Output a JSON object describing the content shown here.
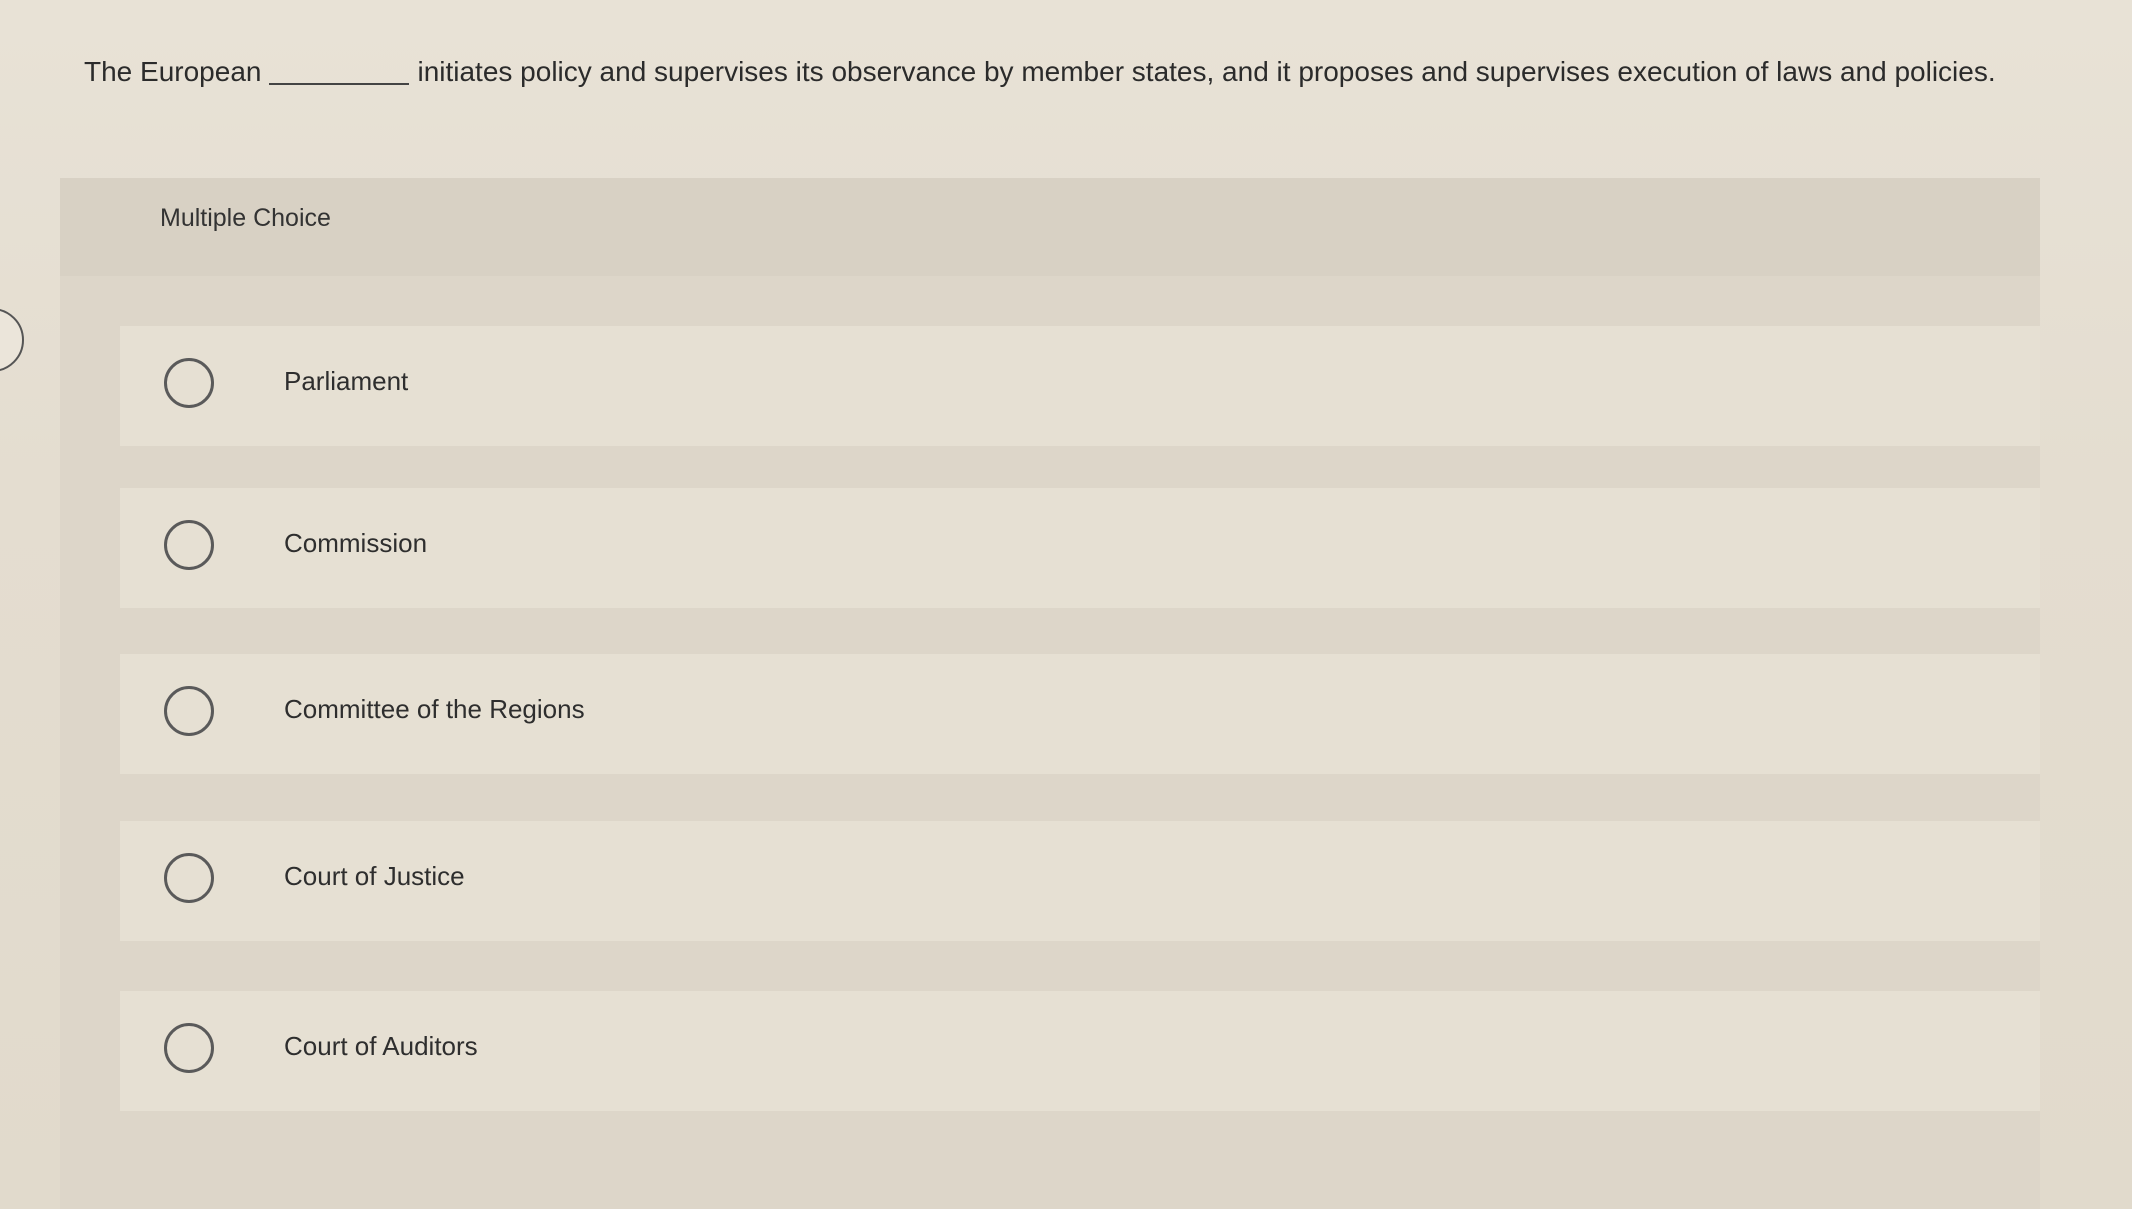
{
  "question": {
    "before_blank": "The European",
    "after_blank": "initiates policy and supervises its observance by member states, and it proposes and supervises execution of laws and policies."
  },
  "multiple_choice": {
    "label": "Multiple Choice",
    "options": [
      {
        "label": "Parliament"
      },
      {
        "label": "Commission"
      },
      {
        "label": "Committee of the Regions"
      },
      {
        "label": "Court of Justice"
      },
      {
        "label": "Court of Auditors"
      }
    ]
  }
}
